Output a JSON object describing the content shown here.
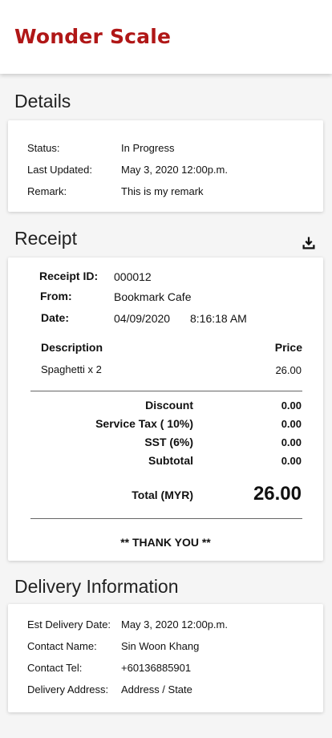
{
  "app": {
    "title": "Wonder Scale"
  },
  "details": {
    "title": "Details",
    "rows": [
      {
        "label": "Status:",
        "value": "In Progress"
      },
      {
        "label": "Last Updated:",
        "value": "May 3, 2020 12:00p.m."
      },
      {
        "label": "Remark:",
        "value": "This is my remark"
      }
    ]
  },
  "receipt": {
    "title": "Receipt",
    "download_icon": "download-icon",
    "receipt_id_label": "Receipt ID:",
    "receipt_id": "000012",
    "from_label": "From:",
    "from": "Bookmark Cafe",
    "date_label": "Date:",
    "date": "04/09/2020",
    "time": "8:16:18 AM",
    "columns": {
      "description": "Description",
      "price": "Price"
    },
    "items": [
      {
        "description": "Spaghetti x 2",
        "price": "26.00"
      }
    ],
    "summary": [
      {
        "label": "Discount",
        "value": "0.00"
      },
      {
        "label": "Service Tax ( 10%)",
        "value": "0.00"
      },
      {
        "label": "SST (6%)",
        "value": "0.00"
      },
      {
        "label": "Subtotal",
        "value": "0.00"
      }
    ],
    "total_label": "Total (MYR)",
    "total": "26.00",
    "thank_you": "** THANK YOU **"
  },
  "delivery": {
    "title": "Delivery Information",
    "rows": [
      {
        "label": "Est Delivery Date:",
        "value": "May 3, 2020 12:00p.m."
      },
      {
        "label": "Contact Name:",
        "value": "Sin Woon Khang"
      },
      {
        "label": "Contact Tel:",
        "value": "+60136885901"
      },
      {
        "label": "Delivery Address:",
        "value": "Address / State"
      }
    ]
  },
  "colors": {
    "brand": "#b01717",
    "background": "#f5f5f5",
    "card": "#ffffff"
  }
}
